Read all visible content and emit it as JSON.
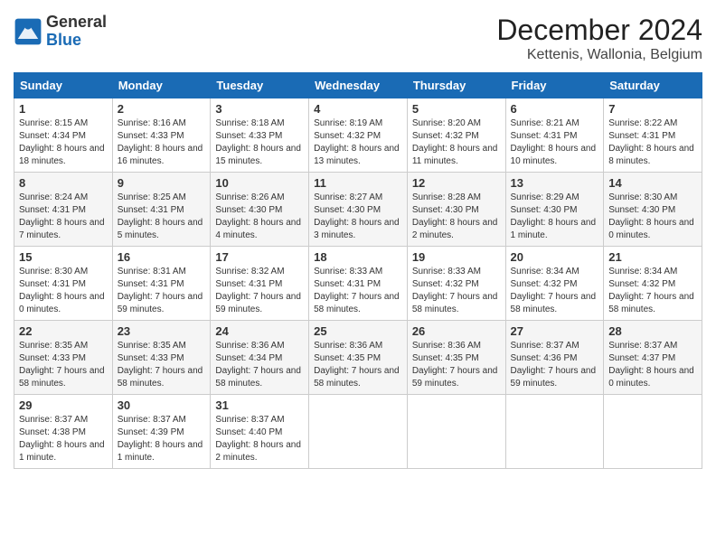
{
  "header": {
    "logo_text_general": "General",
    "logo_text_blue": "Blue",
    "title": "December 2024",
    "subtitle": "Kettenis, Wallonia, Belgium"
  },
  "calendar": {
    "days_of_week": [
      "Sunday",
      "Monday",
      "Tuesday",
      "Wednesday",
      "Thursday",
      "Friday",
      "Saturday"
    ],
    "weeks": [
      [
        null,
        {
          "day": "2",
          "sunrise": "8:16 AM",
          "sunset": "4:33 PM",
          "daylight": "8 hours and 16 minutes."
        },
        {
          "day": "3",
          "sunrise": "8:18 AM",
          "sunset": "4:33 PM",
          "daylight": "8 hours and 15 minutes."
        },
        {
          "day": "4",
          "sunrise": "8:19 AM",
          "sunset": "4:32 PM",
          "daylight": "8 hours and 13 minutes."
        },
        {
          "day": "5",
          "sunrise": "8:20 AM",
          "sunset": "4:32 PM",
          "daylight": "8 hours and 11 minutes."
        },
        {
          "day": "6",
          "sunrise": "8:21 AM",
          "sunset": "4:31 PM",
          "daylight": "8 hours and 10 minutes."
        },
        {
          "day": "7",
          "sunrise": "8:22 AM",
          "sunset": "4:31 PM",
          "daylight": "8 hours and 8 minutes."
        }
      ],
      [
        {
          "day": "1",
          "sunrise": "8:15 AM",
          "sunset": "4:34 PM",
          "daylight": "8 hours and 18 minutes."
        },
        {
          "day": "8",
          "sunrise": "8:24 AM",
          "sunset": "4:31 PM",
          "daylight": "8 hours and 7 minutes."
        },
        {
          "day": "9",
          "sunrise": "8:25 AM",
          "sunset": "4:31 PM",
          "daylight": "8 hours and 5 minutes."
        },
        {
          "day": "10",
          "sunrise": "8:26 AM",
          "sunset": "4:30 PM",
          "daylight": "8 hours and 4 minutes."
        },
        {
          "day": "11",
          "sunrise": "8:27 AM",
          "sunset": "4:30 PM",
          "daylight": "8 hours and 3 minutes."
        },
        {
          "day": "12",
          "sunrise": "8:28 AM",
          "sunset": "4:30 PM",
          "daylight": "8 hours and 2 minutes."
        },
        {
          "day": "13",
          "sunrise": "8:29 AM",
          "sunset": "4:30 PM",
          "daylight": "8 hours and 1 minute."
        },
        {
          "day": "14",
          "sunrise": "8:30 AM",
          "sunset": "4:30 PM",
          "daylight": "8 hours and 0 minutes."
        }
      ],
      [
        {
          "day": "15",
          "sunrise": "8:30 AM",
          "sunset": "4:31 PM",
          "daylight": "8 hours and 0 minutes."
        },
        {
          "day": "16",
          "sunrise": "8:31 AM",
          "sunset": "4:31 PM",
          "daylight": "7 hours and 59 minutes."
        },
        {
          "day": "17",
          "sunrise": "8:32 AM",
          "sunset": "4:31 PM",
          "daylight": "7 hours and 59 minutes."
        },
        {
          "day": "18",
          "sunrise": "8:33 AM",
          "sunset": "4:31 PM",
          "daylight": "7 hours and 58 minutes."
        },
        {
          "day": "19",
          "sunrise": "8:33 AM",
          "sunset": "4:32 PM",
          "daylight": "7 hours and 58 minutes."
        },
        {
          "day": "20",
          "sunrise": "8:34 AM",
          "sunset": "4:32 PM",
          "daylight": "7 hours and 58 minutes."
        },
        {
          "day": "21",
          "sunrise": "8:34 AM",
          "sunset": "4:32 PM",
          "daylight": "7 hours and 58 minutes."
        }
      ],
      [
        {
          "day": "22",
          "sunrise": "8:35 AM",
          "sunset": "4:33 PM",
          "daylight": "7 hours and 58 minutes."
        },
        {
          "day": "23",
          "sunrise": "8:35 AM",
          "sunset": "4:33 PM",
          "daylight": "7 hours and 58 minutes."
        },
        {
          "day": "24",
          "sunrise": "8:36 AM",
          "sunset": "4:34 PM",
          "daylight": "7 hours and 58 minutes."
        },
        {
          "day": "25",
          "sunrise": "8:36 AM",
          "sunset": "4:35 PM",
          "daylight": "7 hours and 58 minutes."
        },
        {
          "day": "26",
          "sunrise": "8:36 AM",
          "sunset": "4:35 PM",
          "daylight": "7 hours and 59 minutes."
        },
        {
          "day": "27",
          "sunrise": "8:37 AM",
          "sunset": "4:36 PM",
          "daylight": "7 hours and 59 minutes."
        },
        {
          "day": "28",
          "sunrise": "8:37 AM",
          "sunset": "4:37 PM",
          "daylight": "8 hours and 0 minutes."
        }
      ],
      [
        {
          "day": "29",
          "sunrise": "8:37 AM",
          "sunset": "4:38 PM",
          "daylight": "8 hours and 1 minute."
        },
        {
          "day": "30",
          "sunrise": "8:37 AM",
          "sunset": "4:39 PM",
          "daylight": "8 hours and 1 minute."
        },
        {
          "day": "31",
          "sunrise": "8:37 AM",
          "sunset": "4:40 PM",
          "daylight": "8 hours and 2 minutes."
        },
        null,
        null,
        null,
        null
      ]
    ]
  }
}
